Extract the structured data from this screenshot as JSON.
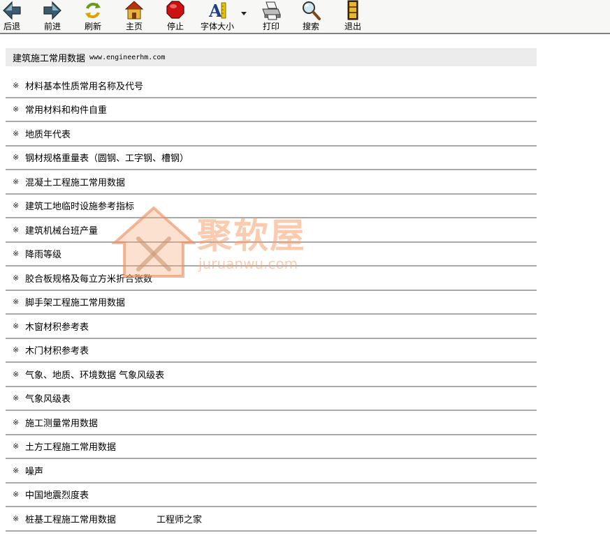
{
  "toolbar": {
    "buttons": [
      {
        "label": "后退",
        "icon": "back-arrow-icon"
      },
      {
        "label": "前进",
        "icon": "forward-arrow-icon"
      },
      {
        "label": "刷新",
        "icon": "refresh-icon"
      },
      {
        "label": "主页",
        "icon": "home-icon"
      },
      {
        "label": "停止",
        "icon": "stop-icon"
      },
      {
        "label": "字体大小",
        "icon": "font-size-icon"
      },
      {
        "label": "打印",
        "icon": "printer-icon"
      },
      {
        "label": "搜索",
        "icon": "search-icon"
      },
      {
        "label": "退出",
        "icon": "exit-icon"
      }
    ]
  },
  "header": {
    "title": "建筑施工常用数据",
    "url": "www.engineerhm.com"
  },
  "bullet": "※",
  "items": [
    {
      "label": "材料基本性质常用名称及代号"
    },
    {
      "label": "常用材料和构件自重"
    },
    {
      "label": "地质年代表"
    },
    {
      "label": "钢材规格重量表（圆钢、工字钢、槽钢）"
    },
    {
      "label": "混凝土工程施工常用数据"
    },
    {
      "label": "建筑工地临时设施参考指标"
    },
    {
      "label": "建筑机械台班产量"
    },
    {
      "label": "降雨等级"
    },
    {
      "label": "胶合板规格及每立方米折合张数"
    },
    {
      "label": "脚手架工程施工常用数据"
    },
    {
      "label": "木窗材积参考表"
    },
    {
      "label": "木门材积参考表"
    },
    {
      "label": "气象、地质、环境数据 气象风级表"
    },
    {
      "label": "气象风级表"
    },
    {
      "label": "施工测量常用数据"
    },
    {
      "label": "土方工程施工常用数据"
    },
    {
      "label": "噪声"
    },
    {
      "label": "中国地震烈度表"
    },
    {
      "label": "桩基工程施工常用数据",
      "extra": "工程师之家"
    }
  ],
  "watermark": {
    "main": "聚软屋",
    "sub": "juruanwu.com"
  }
}
